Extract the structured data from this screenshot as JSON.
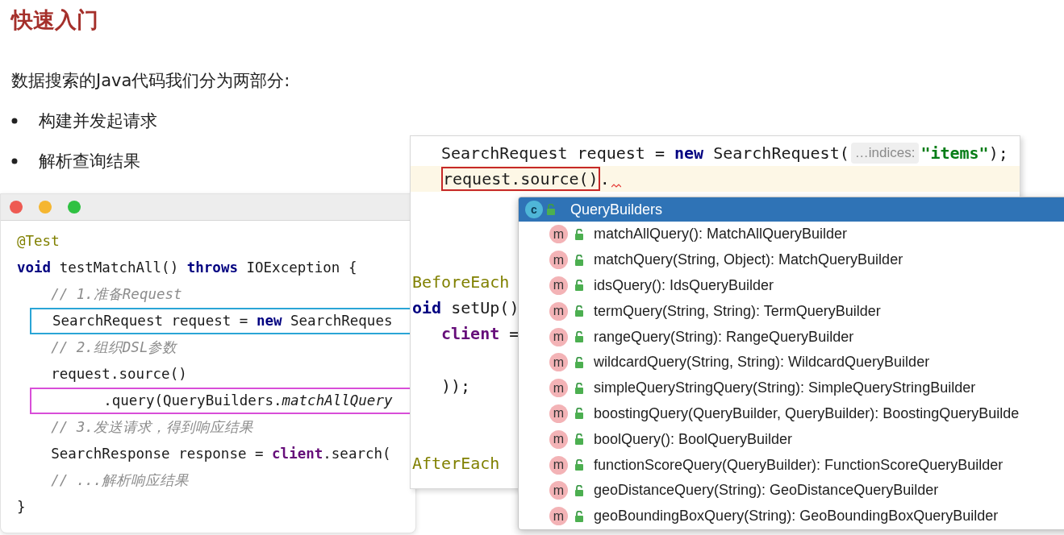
{
  "slide": {
    "title": "快速入门",
    "intro": "数据搜索的Java代码我们分为两部分:",
    "bullets": [
      "构建并发起请求",
      "解析查询结果"
    ]
  },
  "code_window": {
    "lines": [
      {
        "tokens": [
          {
            "text": "@Test",
            "kind": "annotation"
          }
        ]
      },
      {
        "tokens": [
          {
            "text": "void",
            "kind": "keyword"
          },
          {
            "text": " testMatchAll() ",
            "kind": "plain"
          },
          {
            "text": "throws",
            "kind": "keyword"
          },
          {
            "text": " IOException {",
            "kind": "plain"
          }
        ]
      },
      {
        "tokens": [
          {
            "text": "    // 1.准备Request",
            "kind": "comment"
          }
        ]
      },
      {
        "tokens": [
          {
            "text": "SearchRequest request = ",
            "kind": "plain"
          },
          {
            "text": "new",
            "kind": "keyword"
          },
          {
            "text": " SearchReques",
            "kind": "plain"
          }
        ],
        "color": "#2aa5d6"
      },
      {
        "tokens": [
          {
            "text": "    // 2.组织DSL参数",
            "kind": "comment"
          }
        ]
      },
      {
        "tokens": [
          {
            "text": "    request.source()",
            "kind": "plain"
          }
        ]
      },
      {
        "tokens": [
          {
            "text": "      .query(QueryBuilders.",
            "kind": "plain"
          },
          {
            "text": "matchAllQuery",
            "kind": "italic"
          }
        ],
        "color": "#d84ed8"
      },
      {
        "tokens": [
          {
            "text": "    // 3.发送请求，得到响应结果",
            "kind": "comment"
          }
        ]
      },
      {
        "tokens": [
          {
            "text": "    SearchResponse response = ",
            "kind": "plain"
          },
          {
            "text": "client",
            "kind": "field"
          },
          {
            "text": ".search(",
            "kind": "plain"
          }
        ]
      },
      {
        "tokens": [
          {
            "text": "    // ...解析响应结果",
            "kind": "comment"
          }
        ]
      },
      {
        "tokens": [
          {
            "text": "}",
            "kind": "plain"
          }
        ]
      }
    ]
  },
  "editor": {
    "top_lines": [
      {
        "tokens": [
          {
            "text": "SearchRequest request = ",
            "kind": "plain"
          },
          {
            "text": "new",
            "kind": "keyword"
          },
          {
            "text": " SearchRequest(",
            "kind": "plain"
          },
          {
            "text": "…indices:",
            "kind": "hint"
          },
          {
            "text": "\"items\"",
            "kind": "string"
          },
          {
            "text": ");",
            "kind": "plain"
          }
        ],
        "indented": true,
        "current": false,
        "error": false
      },
      {
        "tokens": [
          {
            "text": "request.source()",
            "kind": "error_box"
          },
          {
            "text": ".",
            "kind": "plain"
          }
        ],
        "indented": true,
        "current": true,
        "error": true
      }
    ],
    "segments": [
      {
        "lines": [
          {
            "tokens": [
              {
                "text": "BeforeEach",
                "kind": "annotation"
              }
            ],
            "indented": false
          },
          {
            "tokens": [
              {
                "text": "oid",
                "kind": "keyword"
              },
              {
                "text": " setUp()",
                "kind": "plain"
              }
            ],
            "indented": false
          },
          {
            "tokens": [
              {
                "text": "client",
                "kind": "field"
              },
              {
                "text": " =",
                "kind": "plain"
              }
            ],
            "indented": true
          }
        ]
      },
      {
        "lines": [
          {
            "tokens": [
              {
                "text": "));",
                "kind": "plain"
              }
            ],
            "indented": true
          }
        ]
      },
      {
        "lines": [
          {
            "tokens": [
              {
                "text": "AfterEach",
                "kind": "annotation"
              }
            ],
            "indented": false
          }
        ]
      }
    ]
  },
  "popup": {
    "title_icon": "c",
    "title": "QueryBuilders",
    "items": [
      {
        "icon": "m",
        "text": "matchAllQuery(): MatchAllQueryBuilder"
      },
      {
        "icon": "m",
        "text": "matchQuery(String, Object): MatchQueryBuilder"
      },
      {
        "icon": "m",
        "text": "idsQuery(): IdsQueryBuilder"
      },
      {
        "icon": "m",
        "text": "termQuery(String, String): TermQueryBuilder"
      },
      {
        "icon": "m",
        "text": "rangeQuery(String): RangeQueryBuilder"
      },
      {
        "icon": "m",
        "text": "wildcardQuery(String, String): WildcardQueryBuilder"
      },
      {
        "icon": "m",
        "text": "simpleQueryStringQuery(String): SimpleQueryStringBuilder"
      },
      {
        "icon": "m",
        "text": "boostingQuery(QueryBuilder, QueryBuilder): BoostingQueryBuilde"
      },
      {
        "icon": "m",
        "text": "boolQuery(): BoolQueryBuilder"
      },
      {
        "icon": "m",
        "text": "functionScoreQuery(QueryBuilder): FunctionScoreQueryBuilder"
      },
      {
        "icon": "m",
        "text": "geoDistanceQuery(String): GeoDistanceQueryBuilder"
      },
      {
        "icon": "m",
        "text": "geoBoundingBoxQuery(String): GeoBoundingBoxQueryBuilder"
      }
    ]
  }
}
